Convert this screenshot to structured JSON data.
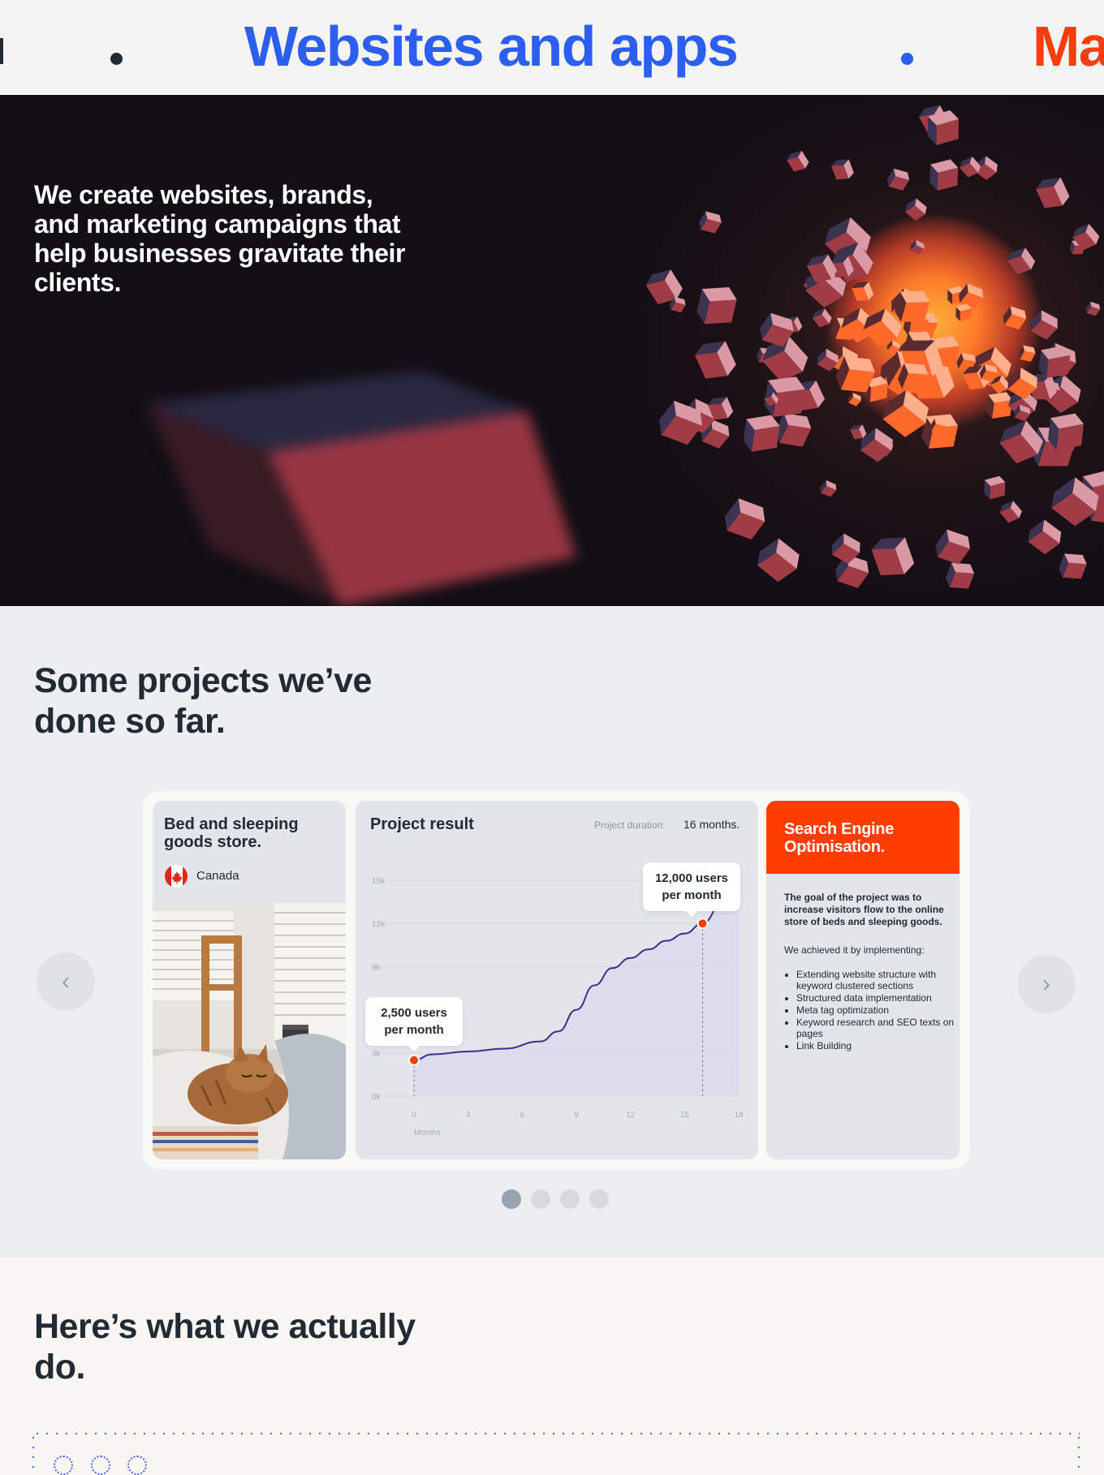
{
  "ticker": {
    "title_main": "Websites and apps",
    "title_next": "Ma",
    "colors": {
      "main": "#2c5ef0",
      "next": "#ff3d0a",
      "dot_dark": "#222b33",
      "dot_blue": "#2c5ef0"
    }
  },
  "hero": {
    "tagline": "We create websites, brands, and marketing campaigns that help businesses gravitate their clients."
  },
  "projects": {
    "heading": "Some projects we’ve done so far.",
    "prev_icon": "chevron-left-icon",
    "next_icon": "chevron-right-icon",
    "client": {
      "name": "Bed and sleeping goods store.",
      "country": "Canada",
      "flag_icon": "canada-flag-icon"
    },
    "result": {
      "title": "Project result",
      "duration_label": "Project duration:",
      "duration_value": "16 months.",
      "start_label": "2,500 users per month",
      "end_label": "12,000 users per month"
    },
    "service": {
      "title": "Search Engine Optimisation.",
      "goal": "The goal of the project was to increase visitors flow to the online store of beds and sleeping goods.",
      "intro": "We achieved it by implementing:",
      "items": [
        "Extending website structure with keyword clustered sections",
        "Structured data implementation",
        "Meta tag optimization",
        "Keyword research and SEO texts on pages",
        "Link Building"
      ]
    },
    "pager": {
      "count": 4,
      "active": 0
    }
  },
  "services": {
    "heading": "Here’s what we actually do."
  },
  "chart_data": {
    "type": "line",
    "title": "",
    "xlabel": "Months",
    "ylabel": "",
    "x_ticks": [
      "0",
      "3",
      "6",
      "9",
      "12",
      "15",
      "18"
    ],
    "y_ticks": [
      "0k",
      "3k",
      "9k",
      "12k",
      "15k"
    ],
    "xlim": [
      0,
      18
    ],
    "ylim": [
      0,
      15000
    ],
    "series": [
      {
        "name": "",
        "x": [
          0,
          1,
          3,
          5,
          7,
          8,
          9,
          10,
          11,
          12,
          13,
          14,
          15,
          16,
          17,
          18
        ],
        "y": [
          2500,
          2900,
          3100,
          3300,
          3800,
          4500,
          6000,
          7700,
          8900,
          9600,
          10200,
          10800,
          11300,
          12000,
          13200,
          14000
        ]
      }
    ],
    "markers": [
      {
        "x": 0,
        "y": 2500,
        "label": "2,500 users per month"
      },
      {
        "x": 16,
        "y": 12000,
        "label": "12,000 users per month"
      }
    ],
    "colors": {
      "line": "#3b2f8f",
      "area": "#d9d8ec",
      "marker": "#ff3d00"
    },
    "grid": true
  }
}
